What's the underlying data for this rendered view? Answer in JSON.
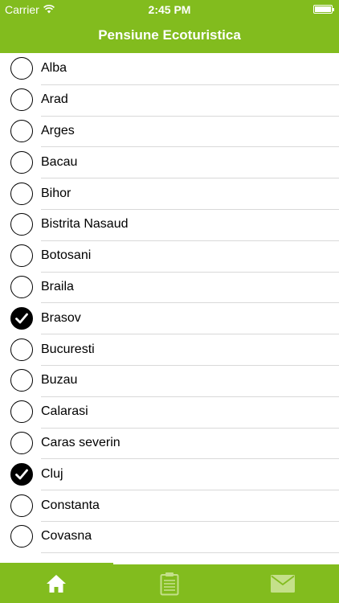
{
  "status_bar": {
    "carrier": "Carrier",
    "time": "2:45 PM"
  },
  "nav": {
    "title": "Pensiune Ecoturistica"
  },
  "counties": [
    {
      "label": "Alba",
      "checked": false
    },
    {
      "label": "Arad",
      "checked": false
    },
    {
      "label": "Arges",
      "checked": false
    },
    {
      "label": "Bacau",
      "checked": false
    },
    {
      "label": "Bihor",
      "checked": false
    },
    {
      "label": "Bistrita Nasaud",
      "checked": false
    },
    {
      "label": "Botosani",
      "checked": false
    },
    {
      "label": "Braila",
      "checked": false
    },
    {
      "label": "Brasov",
      "checked": true
    },
    {
      "label": "Bucuresti",
      "checked": false
    },
    {
      "label": "Buzau",
      "checked": false
    },
    {
      "label": "Calarasi",
      "checked": false
    },
    {
      "label": "Caras severin",
      "checked": false
    },
    {
      "label": "Cluj",
      "checked": true
    },
    {
      "label": "Constanta",
      "checked": false
    },
    {
      "label": "Covasna",
      "checked": false
    }
  ],
  "tabs": [
    {
      "icon": "home-icon",
      "active": true
    },
    {
      "icon": "clipboard-icon",
      "active": false
    },
    {
      "icon": "mail-icon",
      "active": false
    }
  ],
  "colors": {
    "accent": "#82bc1e",
    "tab_active": "#ffffff",
    "tab_inactive": "#c4e08a"
  }
}
